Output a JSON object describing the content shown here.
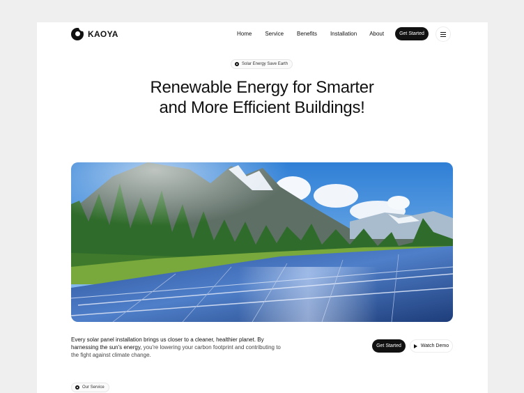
{
  "brand": {
    "name": "KAOYA"
  },
  "nav": {
    "links": [
      "Home",
      "Service",
      "Benefits",
      "Installation",
      "About"
    ],
    "cta": "Get Started"
  },
  "hero": {
    "badge": "Solar Energy Save Earth",
    "headline": "Renewable Energy for Smarter and More Efficient Buildings!",
    "image_alt": "solar panels in a mountain valley"
  },
  "intro": {
    "emphasis_1": "Every solar panel installation brings us closer to a cleaner, healthier planet. By harnessing the sun's energy,",
    "rest": " you're lowering your carbon footprint and contributing to the fight against climate change.",
    "primary_button": "Get Started",
    "secondary_button": "Watch Demo"
  },
  "services": {
    "badge": "Our Service"
  },
  "icons": [
    "logo-icon",
    "menu-icon",
    "badge-icon",
    "play-icon"
  ]
}
